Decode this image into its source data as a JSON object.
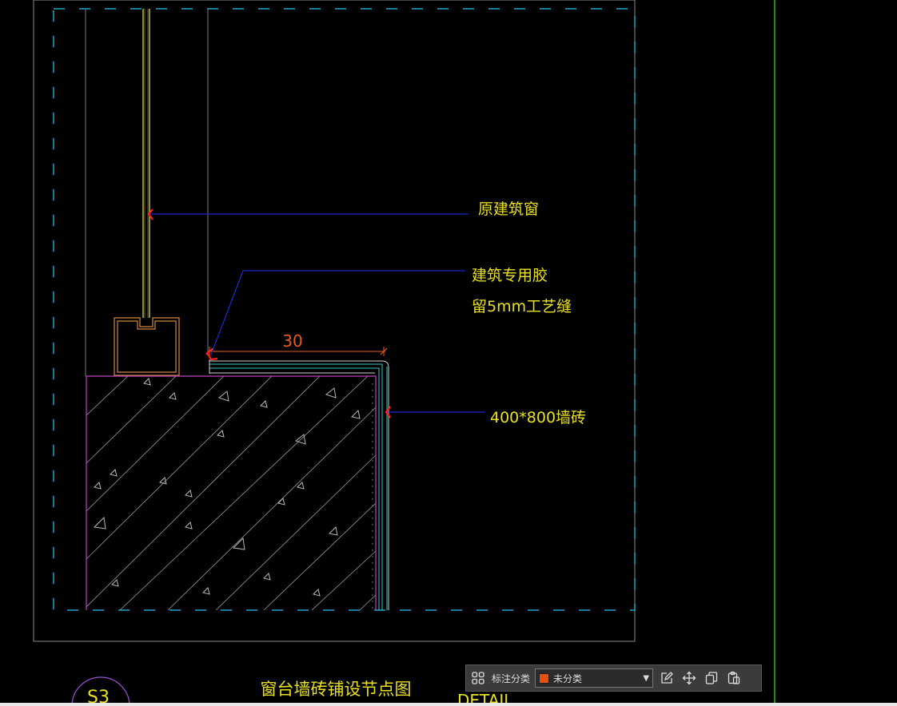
{
  "drawing": {
    "labels": {
      "window": "原建筑窗",
      "adhesive": "建筑专用胶",
      "gap": "留5mm工艺缝",
      "tile": "400*800墙砖",
      "dimension": "30",
      "title": "窗台墙砖铺设节点图",
      "subtitle": "DETAIL",
      "section_mark": "S3"
    },
    "colors": {
      "background": "#000000",
      "annotation_text": "#e8e020",
      "leader": "#2030ff",
      "arrow": "#ff2020",
      "dimension": "#e85a20",
      "viewport_dash": "#1aa6c8",
      "concrete_outline": "#c040c0",
      "window_frame": "#e8e070",
      "sill_profile": "#d08840",
      "tile": "#30c8c8",
      "frame_line": "#8a8a8a",
      "green_rule": "#20c020"
    }
  },
  "toolbar": {
    "category_label": "标注分类",
    "category_value": "未分类",
    "swatch_color": "#e85010",
    "icons": [
      "group-icon",
      "edit-icon",
      "move-icon",
      "copy-icon",
      "paste-icon"
    ]
  }
}
